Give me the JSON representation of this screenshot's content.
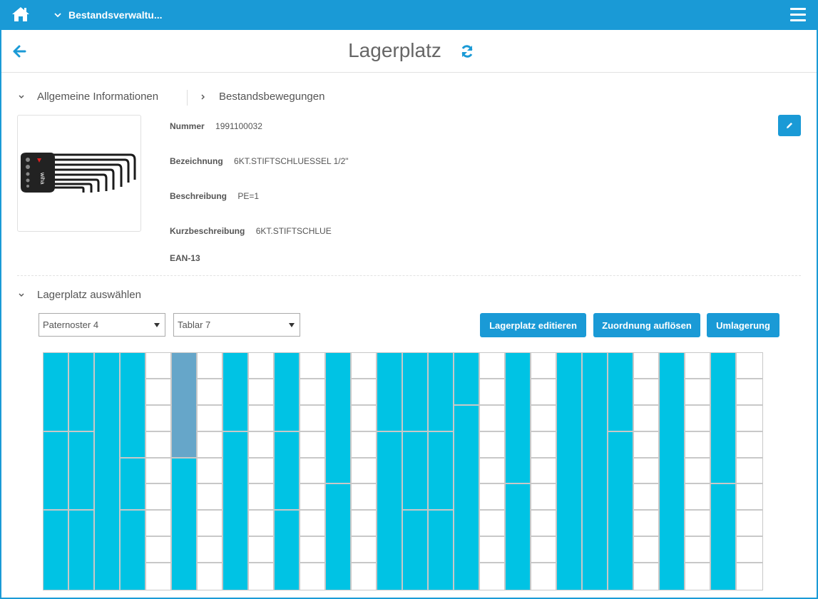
{
  "header": {
    "app_title": "Bestandsverwaltu...",
    "home_icon": "home-icon",
    "menu_icon": "hamburger-menu-icon",
    "page_title": "Lagerplatz"
  },
  "tabs": {
    "general": "Allgemeine Informationen",
    "movements": "Bestandsbewegungen"
  },
  "product": {
    "number_label": "Nummer",
    "number": "1991100032",
    "designation_label": "Bezeichnung",
    "designation": "6KT.STIFTSCHLUESSEL 1/2\"",
    "description_label": "Beschreibung",
    "description": "PE=1",
    "short_label": "Kurzbeschreibung",
    "short": "6KT.STIFTSCHLUE",
    "ean_label": "EAN-13",
    "ean": "",
    "image_brand_text": "wiha"
  },
  "location": {
    "section_title": "Lagerplatz auswählen",
    "paternoster": "Paternoster 4",
    "tablar": "Tablar 7",
    "btn_edit": "Lagerplatz editieren",
    "btn_unassign": "Zuordnung auflösen",
    "btn_relocate": "Umlagerung"
  },
  "colors": {
    "primary": "#1a9ad6",
    "occupied": "#00c3e4",
    "selected": "#66a6c9",
    "empty": "#ffffff"
  },
  "slots": {
    "rows": 9,
    "columns": [
      [
        [
          "occupied",
          3
        ],
        [
          "occupied",
          3
        ],
        [
          "occupied",
          3
        ]
      ],
      [
        [
          "occupied",
          3
        ],
        [
          "occupied",
          3
        ],
        [
          "occupied",
          3
        ]
      ],
      [
        [
          "occupied",
          9
        ]
      ],
      [
        [
          "occupied",
          4
        ],
        [
          "occupied",
          2
        ],
        [
          "occupied",
          3
        ]
      ],
      [
        [
          "empty",
          1
        ],
        [
          "empty",
          1
        ],
        [
          "empty",
          1
        ],
        [
          "empty",
          1
        ],
        [
          "empty",
          1
        ],
        [
          "empty",
          1
        ],
        [
          "empty",
          1
        ],
        [
          "empty",
          1
        ],
        [
          "empty",
          1
        ]
      ],
      [
        [
          "selected",
          4
        ],
        [
          "occupied",
          5
        ]
      ],
      [
        [
          "empty",
          1
        ],
        [
          "empty",
          1
        ],
        [
          "empty",
          1
        ],
        [
          "empty",
          1
        ],
        [
          "empty",
          1
        ],
        [
          "empty",
          1
        ],
        [
          "empty",
          1
        ],
        [
          "empty",
          1
        ],
        [
          "empty",
          1
        ]
      ],
      [
        [
          "occupied",
          3
        ],
        [
          "occupied",
          6
        ]
      ],
      [
        [
          "empty",
          1
        ],
        [
          "empty",
          1
        ],
        [
          "empty",
          1
        ],
        [
          "empty",
          1
        ],
        [
          "empty",
          1
        ],
        [
          "empty",
          1
        ],
        [
          "empty",
          1
        ],
        [
          "empty",
          1
        ],
        [
          "empty",
          1
        ]
      ],
      [
        [
          "occupied",
          3
        ],
        [
          "occupied",
          3
        ],
        [
          "occupied",
          3
        ]
      ],
      [
        [
          "empty",
          1
        ],
        [
          "empty",
          1
        ],
        [
          "empty",
          1
        ],
        [
          "empty",
          1
        ],
        [
          "empty",
          1
        ],
        [
          "empty",
          1
        ],
        [
          "empty",
          1
        ],
        [
          "empty",
          1
        ],
        [
          "empty",
          1
        ]
      ],
      [
        [
          "occupied",
          5
        ],
        [
          "occupied",
          4
        ]
      ],
      [
        [
          "empty",
          1
        ],
        [
          "empty",
          1
        ],
        [
          "empty",
          1
        ],
        [
          "empty",
          1
        ],
        [
          "empty",
          1
        ],
        [
          "empty",
          1
        ],
        [
          "empty",
          1
        ],
        [
          "empty",
          1
        ],
        [
          "empty",
          1
        ]
      ],
      [
        [
          "occupied",
          3
        ],
        [
          "occupied",
          6
        ]
      ],
      [
        [
          "occupied",
          3
        ],
        [
          "occupied",
          3
        ],
        [
          "occupied",
          3
        ]
      ],
      [
        [
          "occupied",
          3
        ],
        [
          "occupied",
          3
        ],
        [
          "occupied",
          3
        ]
      ],
      [
        [
          "occupied",
          2
        ],
        [
          "occupied",
          7
        ]
      ],
      [
        [
          "empty",
          1
        ],
        [
          "empty",
          1
        ],
        [
          "empty",
          1
        ],
        [
          "empty",
          1
        ],
        [
          "empty",
          1
        ],
        [
          "empty",
          1
        ],
        [
          "empty",
          1
        ],
        [
          "empty",
          1
        ],
        [
          "empty",
          1
        ]
      ],
      [
        [
          "occupied",
          5
        ],
        [
          "occupied",
          4
        ]
      ],
      [
        [
          "empty",
          1
        ],
        [
          "empty",
          1
        ],
        [
          "empty",
          1
        ],
        [
          "empty",
          1
        ],
        [
          "empty",
          1
        ],
        [
          "empty",
          1
        ],
        [
          "empty",
          1
        ],
        [
          "empty",
          1
        ],
        [
          "empty",
          1
        ]
      ],
      [
        [
          "occupied",
          9
        ]
      ],
      [
        [
          "occupied",
          9
        ]
      ],
      [
        [
          "occupied",
          3
        ],
        [
          "occupied",
          6
        ]
      ],
      [
        [
          "empty",
          1
        ],
        [
          "empty",
          1
        ],
        [
          "empty",
          1
        ],
        [
          "empty",
          1
        ],
        [
          "empty",
          1
        ],
        [
          "empty",
          1
        ],
        [
          "empty",
          1
        ],
        [
          "empty",
          1
        ],
        [
          "empty",
          1
        ]
      ],
      [
        [
          "occupied",
          9
        ]
      ],
      [
        [
          "empty",
          1
        ],
        [
          "empty",
          1
        ],
        [
          "empty",
          1
        ],
        [
          "empty",
          1
        ],
        [
          "empty",
          1
        ],
        [
          "empty",
          1
        ],
        [
          "empty",
          1
        ],
        [
          "empty",
          1
        ],
        [
          "empty",
          1
        ]
      ],
      [
        [
          "occupied",
          5
        ],
        [
          "occupied",
          4
        ]
      ],
      [
        [
          "empty",
          1
        ],
        [
          "empty",
          1
        ],
        [
          "empty",
          1
        ],
        [
          "empty",
          1
        ],
        [
          "empty",
          1
        ],
        [
          "empty",
          1
        ],
        [
          "empty",
          1
        ],
        [
          "empty",
          1
        ],
        [
          "empty",
          1
        ]
      ]
    ]
  }
}
